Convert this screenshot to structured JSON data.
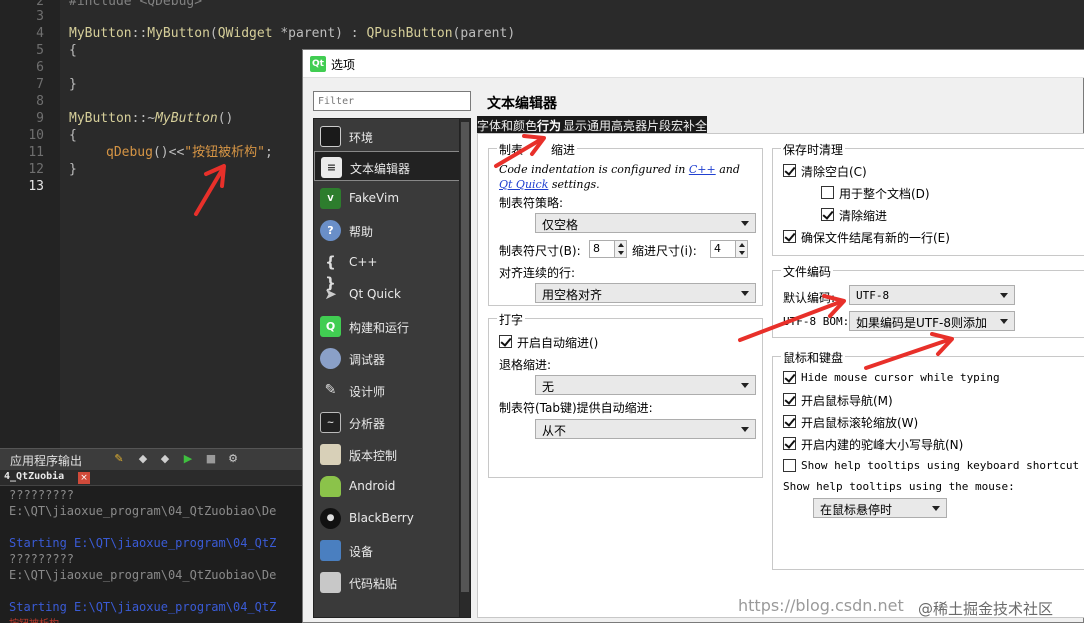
{
  "editor": {
    "line_numbers": [
      "2",
      "3",
      "4",
      "5",
      "6",
      "7",
      "8",
      "9",
      "10",
      "11",
      "12",
      "13"
    ],
    "line2": "#include <QDebug>",
    "line4_class": "MyButton",
    "line4_sep": "::",
    "line4_fn": "MyButton",
    "line4_rest_a": "(",
    "line4_type": "QWidget",
    "line4_rest_b": " *parent) : ",
    "line4_base": "QPushButton",
    "line4_rest_c": "(parent)",
    "line5": "{",
    "line7": "}",
    "line9_class": "MyButton",
    "line9_sep": "::~",
    "line9_fn": "MyButton",
    "line9_rest": "()",
    "line10": "{",
    "line11_fn": "qDebug",
    "line11_op": "()<<",
    "line11_str": "\"按钮被析构\"",
    "line11_end": ";",
    "line12": "}"
  },
  "output": {
    "title": "应用程序输出",
    "tab_label": "4_QtZuobia",
    "tab_close": "×",
    "lines": [
      "?????????",
      "E:\\QT\\jiaoxue_program\\04_QtZuobiao\\De",
      "Starting E:\\QT\\jiaoxue_program\\04_QtZ",
      "?????????",
      "E:\\QT\\jiaoxue_program\\04_QtZuobiao\\De",
      "Starting E:\\QT\\jiaoxue_program\\04_QtZ"
    ],
    "last_line": "按钮被析构"
  },
  "dialog": {
    "title": "选项",
    "title_icon": "Qt",
    "filter_placeholder": "Filter",
    "categories": [
      {
        "label": "环境",
        "icon": "monitor-icon"
      },
      {
        "label": "文本编辑器",
        "icon": "text-editor-icon"
      },
      {
        "label": "FakeVim",
        "icon": "fakevim-icon"
      },
      {
        "label": "帮助",
        "icon": "help-icon"
      },
      {
        "label": "C++",
        "icon": "cpp-braces-icon"
      },
      {
        "label": "Qt Quick",
        "icon": "qtquick-icon"
      },
      {
        "label": "构建和运行",
        "icon": "build-run-icon"
      },
      {
        "label": "调试器",
        "icon": "debugger-icon"
      },
      {
        "label": "设计师",
        "icon": "designer-icon"
      },
      {
        "label": "分析器",
        "icon": "analyzer-icon"
      },
      {
        "label": "版本控制",
        "icon": "version-control-icon"
      },
      {
        "label": "Android",
        "icon": "android-icon"
      },
      {
        "label": "BlackBerry",
        "icon": "blackberry-icon"
      },
      {
        "label": "设备",
        "icon": "devices-icon"
      },
      {
        "label": "代码粘贴",
        "icon": "code-paste-icon"
      }
    ],
    "selected_category": "文本编辑器",
    "page_title": "文本编辑器",
    "tabs": [
      "字体和颜色",
      "行为",
      "显示",
      "通用高亮器",
      "片段",
      "宏",
      "补全"
    ],
    "active_tab": "行为",
    "tab_glyphs": {
      "t0": "字",
      "t1": "体",
      "t2": "和",
      "t3": "颜",
      "t4": "色",
      "t5": "行",
      "t6": "为",
      "t7": "显",
      "t8": "示",
      "t9": "通",
      "t10": "用",
      "t11": "高",
      "t12": "亮",
      "t13": "器",
      "t14": "片",
      "t15": "段",
      "t16": "宏",
      "t17": "补",
      "t18": "全"
    },
    "tabs_indent": {
      "legend": "制表符和缩进",
      "legend_visible": "制表",
      "legend_tail": "缩进",
      "code_indent_pre": "Code indentation is configured in ",
      "code_indent_link1": "C++",
      "code_indent_mid": " and",
      "code_indent_link2": "Qt Quick",
      "code_indent_post": " settings.",
      "tab_policy_label": "制表符策略:",
      "tab_policy_value": "仅空格",
      "tab_size_label": "制表符尺寸(B):",
      "tab_size_value": "8",
      "indent_size_label": "缩进尺寸(i):",
      "indent_size_value": "4",
      "align_label": "对齐连续的行:",
      "align_value": "用空格对齐"
    },
    "typing": {
      "legend": "打字",
      "auto_indent_label": "开启自动缩进()",
      "auto_indent_checked": true,
      "backspace_label": "退格缩进:",
      "backspace_value": "无",
      "tab_key_label": "制表符(Tab键)提供自动缩进:",
      "tab_key_value": "从不"
    },
    "cleanup": {
      "legend": "保存时清理",
      "clean_ws_label": "清除空白(C)",
      "clean_ws_checked": true,
      "entire_doc_label": "用于整个文档(D)",
      "entire_doc_checked": false,
      "clean_indent_label": "清除缩进",
      "clean_indent_checked": true,
      "newline_label": "确保文件结尾有新的一行(E)",
      "newline_checked": true
    },
    "encoding": {
      "legend": "文件编码",
      "default_label": "默认编码:",
      "default_value": "UTF-8",
      "bom_label": "UTF-8 BOM:",
      "bom_value": "如果编码是UTF-8则添加"
    },
    "mouse_keyboard": {
      "legend": "鼠标和键盘",
      "hide_cursor_label": "Hide mouse cursor while typing",
      "hide_cursor_checked": true,
      "mouse_nav_label": "开启鼠标导航(M)",
      "mouse_nav_checked": true,
      "wheel_zoom_label": "开启鼠标滚轮缩放(W)",
      "wheel_zoom_checked": true,
      "camel_label": "开启内建的驼峰大小写导航(N)",
      "camel_checked": true,
      "kb_tooltips_label": "Show help tooltips using keyboard shortcut (Alt)",
      "kb_tooltips_checked": false,
      "mouse_tooltips_label": "Show help tooltips using the mouse:",
      "mouse_tooltips_value": "在鼠标悬停时"
    }
  },
  "watermark": {
    "url": "https://blog.csdn.net",
    "brand": "@稀土掘金技术社区"
  },
  "colors": {
    "annotation": "#e8302a",
    "link": "#2040d0",
    "sidebar_bg": "#3a3a3a",
    "editor_bg": "#2a2a2a"
  }
}
